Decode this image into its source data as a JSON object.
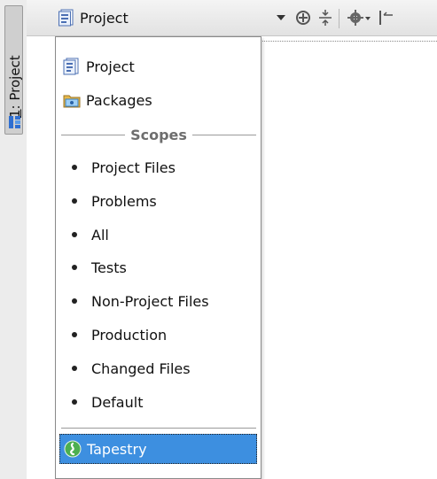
{
  "tool_window": {
    "tab_number": "1",
    "tab_name": ": Project"
  },
  "header": {
    "view_selector_label": "Project"
  },
  "popup": {
    "views": [
      {
        "label": "Project",
        "icon": "project-icon"
      },
      {
        "label": "Packages",
        "icon": "packages-icon"
      }
    ],
    "scopes_title": "Scopes",
    "scopes": [
      "Project Files",
      "Problems",
      "All",
      "Tests",
      "Non-Project Files",
      "Production",
      "Changed Files",
      "Default"
    ],
    "extra": {
      "label": "Tapestry",
      "icon": "tapestry-icon",
      "selected": true
    }
  },
  "colors": {
    "selection": "#3d8fe0",
    "tapestry_icon": "#4caf50"
  }
}
